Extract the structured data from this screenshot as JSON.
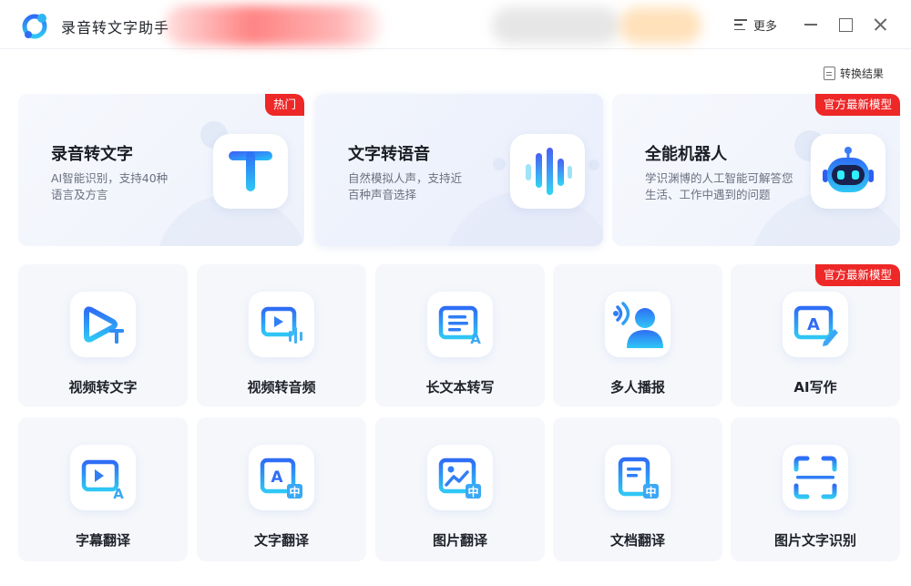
{
  "app": {
    "title": "录音转文字助手"
  },
  "titlebar": {
    "more_label": "更多"
  },
  "results_link": {
    "label": "转换结果"
  },
  "feature_cards": [
    {
      "title": "录音转文字",
      "desc": "AI智能识别，支持40种语言及方言",
      "badge": "热门",
      "icon": "text-t-icon"
    },
    {
      "title": "文字转语音",
      "desc": "自然模拟人声，支持近百种声音选择",
      "badge": "",
      "icon": "soundwave-icon"
    },
    {
      "title": "全能机器人",
      "desc": "学识渊博的人工智能可解答您生活、工作中遇到的问题",
      "badge": "官方最新模型",
      "icon": "robot-icon"
    }
  ],
  "tools": [
    {
      "label": "视频转文字",
      "icon": "video-to-text-icon",
      "badge": ""
    },
    {
      "label": "视频转音频",
      "icon": "video-to-audio-icon",
      "badge": ""
    },
    {
      "label": "长文本转写",
      "icon": "long-text-icon",
      "badge": ""
    },
    {
      "label": "多人播报",
      "icon": "multi-speaker-icon",
      "badge": ""
    },
    {
      "label": "AI写作",
      "icon": "ai-writing-icon",
      "badge": "官方最新模型"
    },
    {
      "label": "字幕翻译",
      "icon": "subtitle-translate-icon",
      "badge": ""
    },
    {
      "label": "文字翻译",
      "icon": "text-translate-icon",
      "badge": ""
    },
    {
      "label": "图片翻译",
      "icon": "image-translate-icon",
      "badge": ""
    },
    {
      "label": "文档翻译",
      "icon": "document-translate-icon",
      "badge": ""
    },
    {
      "label": "图片文字识别",
      "icon": "image-ocr-icon",
      "badge": ""
    }
  ],
  "colors": {
    "accent": "#2a7bf6",
    "badge": "#ee2727",
    "tile_bg": "#f5f7fb"
  }
}
